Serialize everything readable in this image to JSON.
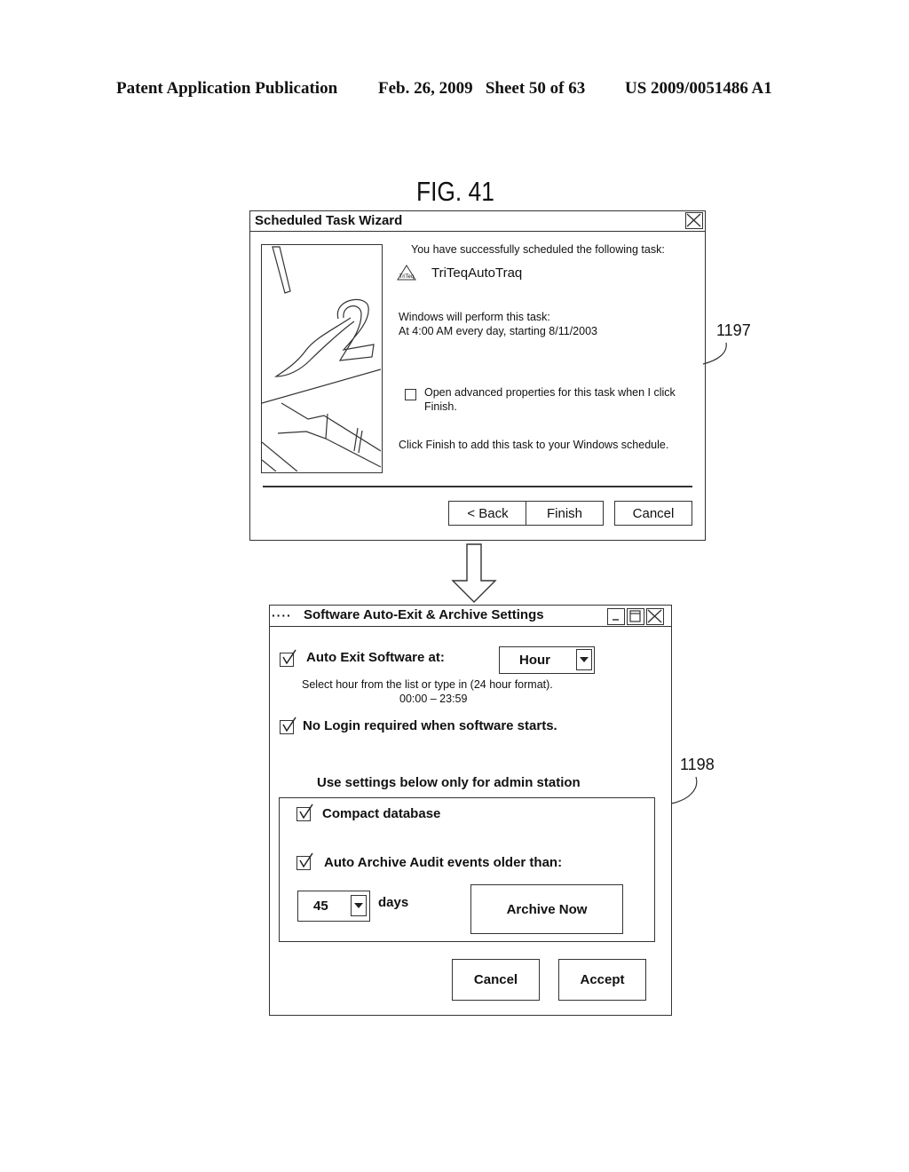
{
  "header": {
    "publication": "Patent Application Publication",
    "date_sheet": "Feb. 26, 2009   Sheet 50 of 63",
    "patent_number": "US 2009/0051486 A1"
  },
  "figure_label": "FIG. 41",
  "wizard": {
    "title": "Scheduled Task Wizard",
    "success_text": "You have successfully scheduled the following task:",
    "task_icon_label": "TriTeq",
    "task_name": "TriTeqAutoTraq",
    "perform_text": "Windows will perform this task:",
    "schedule_text": "At 4:00 AM every day, starting 8/11/2003",
    "advanced_checkbox": {
      "label_line1": "Open advanced properties for this task when I click",
      "label_line2": "Finish.",
      "checked": false
    },
    "finish_hint": "Click Finish to add this task to your Windows schedule.",
    "buttons": {
      "back": "< Back",
      "finish": "Finish",
      "cancel": "Cancel"
    },
    "reference": "1197"
  },
  "settings": {
    "title": "Software Auto-Exit & Archive Settings",
    "title_prefix": "····",
    "auto_exit": {
      "label": "Auto Exit Software at:",
      "checked": true,
      "dropdown_value": "Hour"
    },
    "hour_hint_line1": "Select hour from the list or type in (24 hour format).",
    "hour_hint_line2": "00:00 – 23:59",
    "no_login": {
      "label": "No Login required when software starts.",
      "checked": true
    },
    "admin_heading": "Use settings below only for admin station",
    "compact_db": {
      "label": "Compact database",
      "checked": true
    },
    "auto_archive": {
      "label": "Auto Archive Audit events older than:",
      "checked": true
    },
    "days_value": "45",
    "days_label": "days",
    "buttons": {
      "archive_now": "Archive Now",
      "cancel": "Cancel",
      "accept": "Accept"
    },
    "reference": "1198"
  }
}
